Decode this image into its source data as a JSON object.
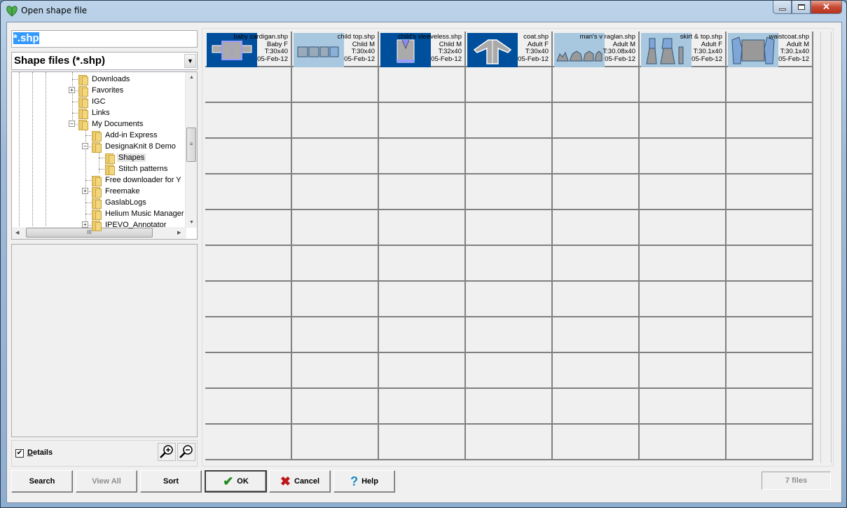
{
  "window": {
    "title": "Open shape file",
    "controls": {
      "minimize": "minimize",
      "maximize": "maximize",
      "close": "close"
    }
  },
  "file_name": {
    "value": "*.shp"
  },
  "file_filter": {
    "selected": "Shape files (*.shp)"
  },
  "folder_tree": {
    "items": [
      {
        "label": "Downloads",
        "icon": "downloads-folder-icon",
        "expander": ""
      },
      {
        "label": "Favorites",
        "icon": "favorites-folder-icon",
        "expander": "+"
      },
      {
        "label": "IGC",
        "icon": "folder-icon",
        "expander": ""
      },
      {
        "label": "Links",
        "icon": "links-folder-icon",
        "expander": ""
      },
      {
        "label": "My Documents",
        "icon": "documents-icon",
        "expander": "-"
      },
      {
        "label": "Add-in Express",
        "icon": "folder-icon",
        "expander": ""
      },
      {
        "label": "DesignaKnit 8 Demo",
        "icon": "folder-icon",
        "expander": "-"
      },
      {
        "label": "Shapes",
        "icon": "folder-icon",
        "expander": "",
        "selected": true
      },
      {
        "label": "Stitch patterns",
        "icon": "folder-icon",
        "expander": ""
      },
      {
        "label": "Free downloader for Y",
        "icon": "folder-icon",
        "expander": ""
      },
      {
        "label": "Freemake",
        "icon": "folder-icon",
        "expander": "+"
      },
      {
        "label": "GaslabLogs",
        "icon": "folder-icon",
        "expander": ""
      },
      {
        "label": "Helium Music Manager",
        "icon": "folder-icon",
        "expander": ""
      },
      {
        "label": "IPEVO_Annotator",
        "icon": "folder-icon",
        "expander": "+"
      }
    ]
  },
  "details": {
    "label": "Details",
    "checked": true
  },
  "buttons": {
    "search": "Search",
    "view_all": "View All",
    "sort": "Sort",
    "ok": "OK",
    "cancel": "Cancel",
    "help": "Help"
  },
  "files": [
    {
      "name": "baby cardigan.shp",
      "size": "Baby F",
      "tension": "T:30x40",
      "date": "05-Feb-12",
      "bg": "#004f9c"
    },
    {
      "name": "child top.shp",
      "size": "Child M",
      "tension": "T:30x40",
      "date": "05-Feb-12",
      "bg": "#a8c8df"
    },
    {
      "name": "child's sleeveless.shp",
      "size": "Child M",
      "tension": "T:32x40",
      "date": "05-Feb-12",
      "bg": "#004f9c"
    },
    {
      "name": "coat.shp",
      "size": "Adult F",
      "tension": "T:30x40",
      "date": "05-Feb-12",
      "bg": "#004f9c"
    },
    {
      "name": "man's v raglan.shp",
      "size": "Adult M",
      "tension": "T:30.08x40",
      "date": "05-Feb-12",
      "bg": "#a8c8df"
    },
    {
      "name": "skirt & top.shp",
      "size": "Adult F",
      "tension": "T:30.1x40",
      "date": "05-Feb-12",
      "bg": "#a8c8df"
    },
    {
      "name": "waistcoat.shp",
      "size": "Adult M",
      "tension": "T:30.1x40",
      "date": "05-Feb-12",
      "bg": "#a8c8df"
    }
  ],
  "status": {
    "file_count": "7 files"
  }
}
